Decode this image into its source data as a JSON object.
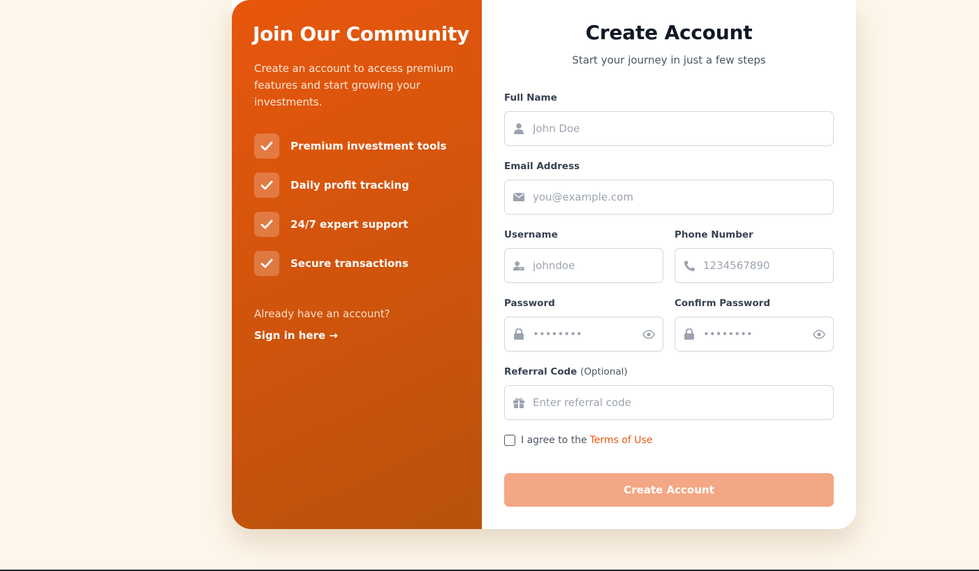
{
  "left_panel": {
    "title": "Join Our Community",
    "lead": "Create an account to access premium features and start growing your investments.",
    "features": [
      {
        "label": "Premium investment tools"
      },
      {
        "label": "Daily profit tracking"
      },
      {
        "label": "24/7 expert support"
      },
      {
        "label": "Secure transactions"
      }
    ],
    "already_text": "Already have an account?",
    "signin_link": "Sign in here →"
  },
  "form": {
    "title": "Create Account",
    "subtitle": "Start your journey in just a few steps",
    "full_name": {
      "label": "Full Name",
      "placeholder": "John Doe",
      "value": "",
      "icon": "user-icon"
    },
    "email": {
      "label": "Email Address",
      "placeholder": "you@example.com",
      "value": "",
      "icon": "envelope-icon"
    },
    "username": {
      "label": "Username",
      "placeholder": "johndoe",
      "value": "",
      "icon": "user-tag-icon"
    },
    "phone": {
      "label": "Phone Number",
      "placeholder": "1234567890",
      "value": "",
      "icon": "phone-icon"
    },
    "password": {
      "label": "Password",
      "placeholder": "••••••••",
      "value": "",
      "icon": "lock-icon"
    },
    "confirm_password": {
      "label": "Confirm Password",
      "placeholder": "••••••••",
      "value": "",
      "icon": "lock-icon"
    },
    "referral": {
      "label": "Referral Code",
      "optional": "(Optional)",
      "placeholder": "Enter referral code",
      "value": "",
      "icon": "gift-icon"
    },
    "terms": {
      "text": "I agree to the",
      "link": "Terms of Use",
      "checked": false
    },
    "submit_label": "Create Account"
  },
  "colors": {
    "accent": "#e8560d",
    "accent_dark": "#b8520b",
    "submit_disabled": "#f4a784",
    "page_bg": "#fdf6ea"
  }
}
